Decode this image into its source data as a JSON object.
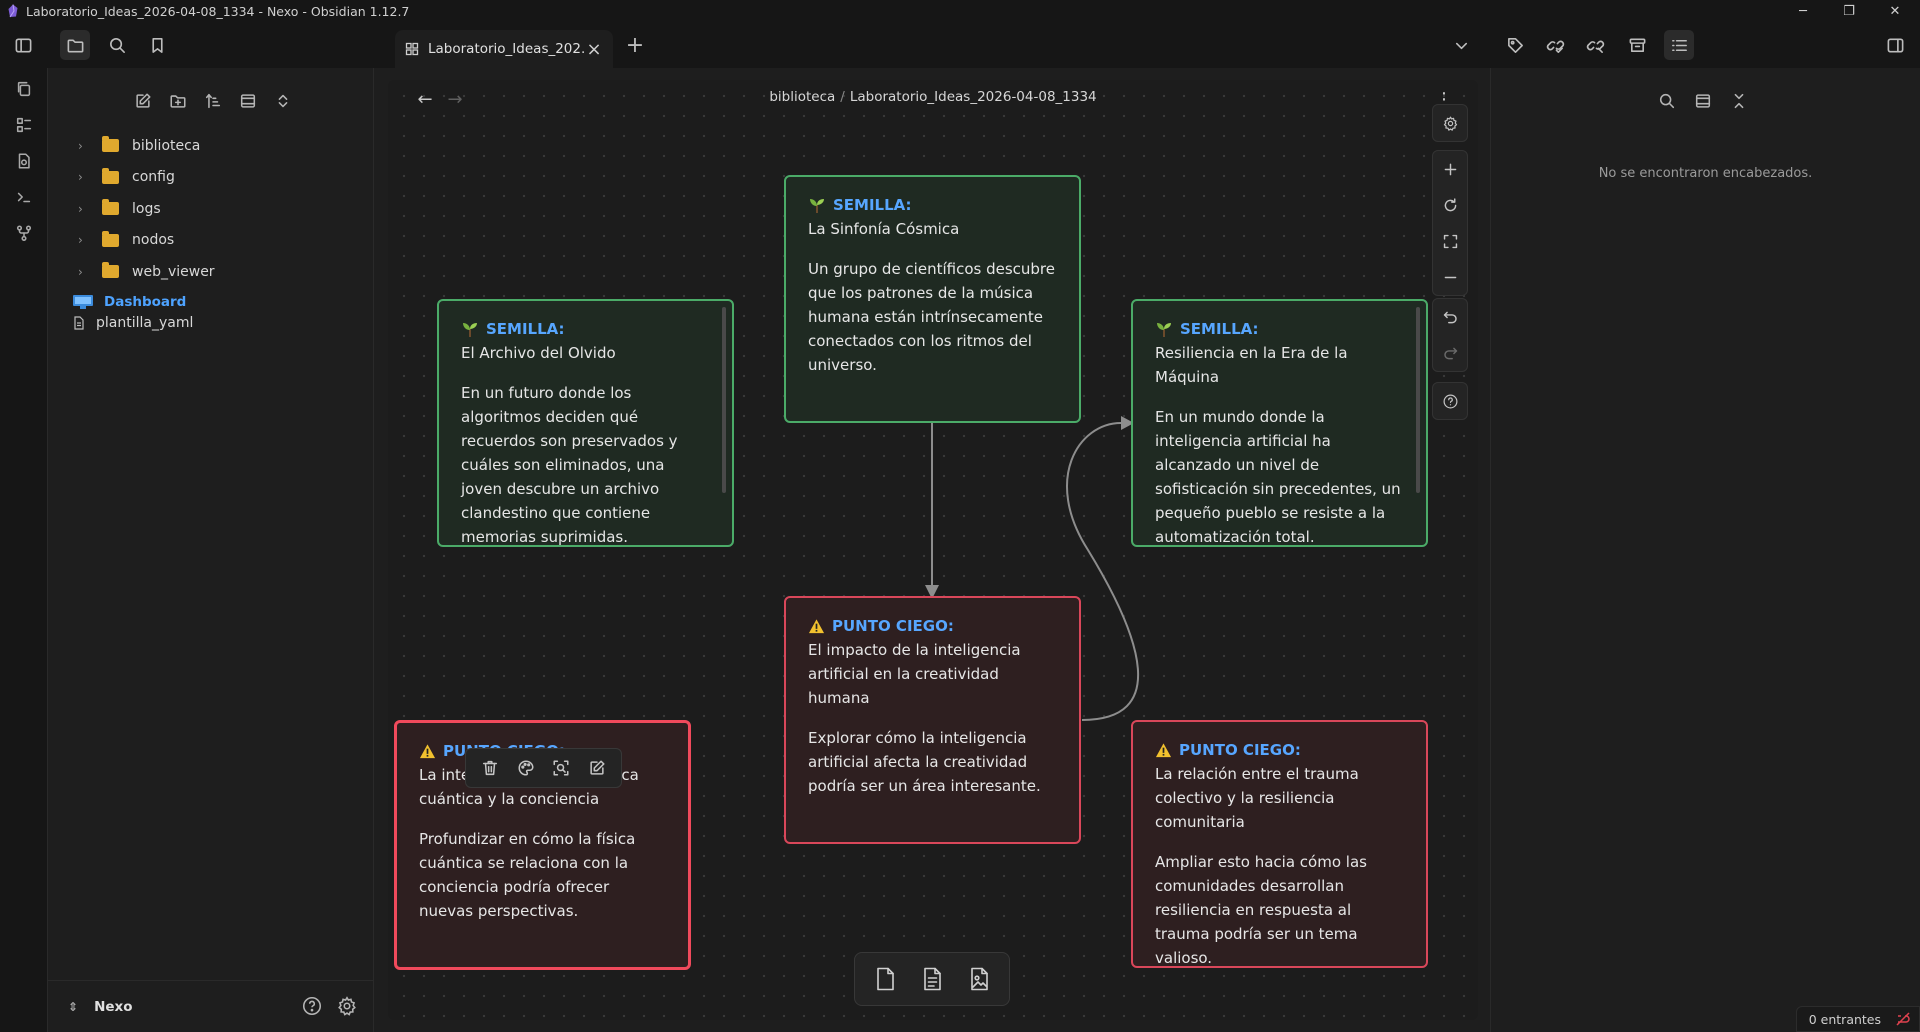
{
  "window": {
    "title": "Laboratorio_Ideas_2026-04-08_1334 - Nexo - Obsidian 1.12.7",
    "minimize": "─",
    "maximize": "❐",
    "close": "✕"
  },
  "tab": {
    "title": "Laboratorio_Ideas_202...",
    "close": "×",
    "new": "+"
  },
  "explorer": {
    "folders": [
      {
        "name": "biblioteca"
      },
      {
        "name": "config"
      },
      {
        "name": "logs"
      },
      {
        "name": "nodos"
      },
      {
        "name": "web_viewer"
      }
    ],
    "files": [
      {
        "name": "Dashboard"
      },
      {
        "name": "plantilla_yaml"
      }
    ],
    "vault_name": "Nexo"
  },
  "canvas": {
    "breadcrumb": {
      "folder": "biblioteca",
      "separator": "/",
      "file": "Laboratorio_Ideas_2026-04-08_1334"
    },
    "back": "←",
    "forward": "→",
    "more": "⋮",
    "cards": [
      {
        "label": "SEMILLA:",
        "title": "La Sinfonía Cósmica",
        "body": "Un grupo de científicos descubre que los patrones de la música humana están intrínsecamente conectados con los ritmos del universo."
      },
      {
        "label": "SEMILLA:",
        "title": "El Archivo del Olvido",
        "body": "En un futuro donde los algoritmos deciden qué recuerdos son preservados y cuáles son eliminados, una joven descubre un archivo clandestino que contiene memorias suprimidas."
      },
      {
        "label": "SEMILLA:",
        "title": "Resiliencia en la Era de la Máquina",
        "body": "En un mundo donde la inteligencia artificial ha alcanzado un nivel de sofisticación sin precedentes, un pequeño pueblo se resiste a la automatización total."
      },
      {
        "label": "PUNTO CIEGO:",
        "title": "El impacto de la inteligencia artificial en la creatividad humana",
        "body": "Explorar cómo la inteligencia artificial afecta la creatividad podría ser un área interesante."
      },
      {
        "label": "PUNTO CIEGO:",
        "title": "La intersección entre la física cuántica y la conciencia",
        "body": "Profundizar en cómo la física cuántica se relaciona con la conciencia podría ofrecer nuevas perspectivas."
      },
      {
        "label": "PUNTO CIEGO:",
        "title": "La relación entre el trauma colectivo y la resiliencia comunitaria",
        "body": "Ampliar esto hacia cómo las comunidades desarrollan resiliencia en respuesta al trauma podría ser un tema valioso."
      }
    ]
  },
  "outline": {
    "empty_message": "No se encontraron encabezados."
  },
  "status": {
    "backlinks": "0 entrantes"
  },
  "colors": {
    "seed_border": "#4bab68",
    "blind_border": "#d9475a",
    "label_accent": "#57a6ff",
    "folder": "#e0a92e"
  }
}
